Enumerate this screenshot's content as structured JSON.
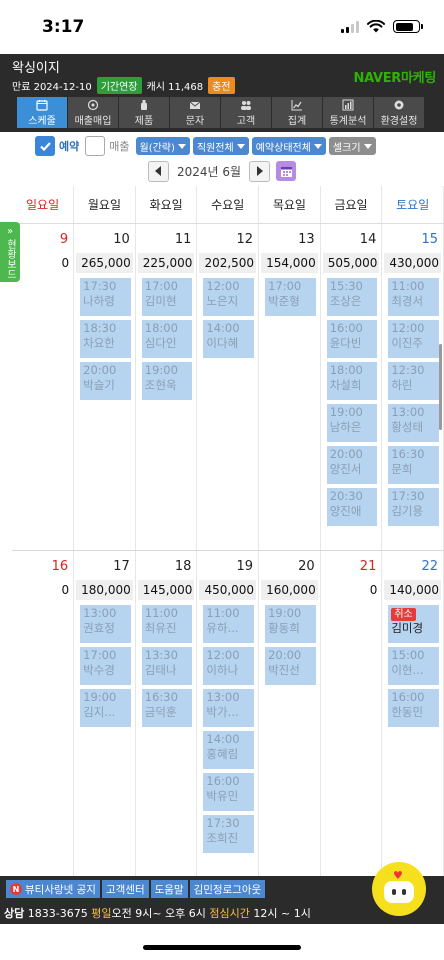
{
  "status_bar": {
    "time": "3:17"
  },
  "header": {
    "shop_name": "왁싱이지",
    "expiry": "만료 2024-12-10",
    "extend_label": "기간연장",
    "cash_label": "캐시 11,468",
    "charge_label": "충전",
    "brand_naver": "NAVER",
    "brand_marketing": "마케팅"
  },
  "toolbar": [
    {
      "label": "스케줄",
      "icon": "calendar-icon",
      "active": true
    },
    {
      "label": "매출매입",
      "icon": "coin-icon"
    },
    {
      "label": "제품",
      "icon": "product-icon"
    },
    {
      "label": "문자",
      "icon": "mail-icon"
    },
    {
      "label": "고객",
      "icon": "people-icon"
    },
    {
      "label": "집계",
      "icon": "line-chart-icon"
    },
    {
      "label": "통계분석",
      "icon": "bar-chart-icon"
    },
    {
      "label": "환경설정",
      "icon": "gear-icon"
    }
  ],
  "filters": {
    "reservation_label": "예약",
    "sales_label": "매출",
    "month_select": "월(간략)",
    "staff_select": "직원전체",
    "status_select": "예약상태전체",
    "cellsize_select": "셀크기"
  },
  "month_nav": {
    "label": "2024년 6월"
  },
  "side_tab": {
    "arrow": "»",
    "label": "현황보드"
  },
  "weekdays": [
    "일요일",
    "월요일",
    "화요일",
    "수요일",
    "목요일",
    "금요일",
    "토요일"
  ],
  "weeks": [
    {
      "days": [
        {
          "num": "9",
          "amount": "0",
          "appts": []
        },
        {
          "num": "10",
          "amount": "265,000",
          "appts": [
            {
              "time": "17:30",
              "name": "나하령"
            },
            {
              "time": "18:30",
              "name": "차요한"
            },
            {
              "time": "20:00",
              "name": "박슬기"
            }
          ]
        },
        {
          "num": "11",
          "amount": "225,000",
          "appts": [
            {
              "time": "17:00",
              "name": "김미현"
            },
            {
              "time": "18:00",
              "name": "심다인"
            },
            {
              "time": "19:00",
              "name": "조현욱"
            }
          ]
        },
        {
          "num": "12",
          "amount": "202,500",
          "appts": [
            {
              "time": "12:00",
              "name": "노은지"
            },
            {
              "time": "14:00",
              "name": "이다혜"
            }
          ]
        },
        {
          "num": "13",
          "amount": "154,000",
          "appts": [
            {
              "time": "17:00",
              "name": "박준형"
            }
          ]
        },
        {
          "num": "14",
          "amount": "505,000",
          "appts": [
            {
              "time": "15:30",
              "name": "조상은"
            },
            {
              "time": "16:00",
              "name": "윤다빈"
            },
            {
              "time": "18:00",
              "name": "차설희"
            },
            {
              "time": "19:00",
              "name": "남하은"
            },
            {
              "time": "20:00",
              "name": "양진서"
            },
            {
              "time": "20:30",
              "name": "양진애"
            }
          ]
        },
        {
          "num": "15",
          "amount": "430,000",
          "appts": [
            {
              "time": "11:00",
              "name": "최경서"
            },
            {
              "time": "12:00",
              "name": "이진주"
            },
            {
              "time": "12:30",
              "name": "하린"
            },
            {
              "time": "13:00",
              "name": "황성태"
            },
            {
              "time": "16:30",
              "name": "문희"
            },
            {
              "time": "17:30",
              "name": "김기용"
            }
          ]
        }
      ]
    },
    {
      "days": [
        {
          "num": "16",
          "amount": "0",
          "appts": []
        },
        {
          "num": "17",
          "amount": "180,000",
          "appts": [
            {
              "time": "13:00",
              "name": "권효정"
            },
            {
              "time": "17:00",
              "name": "박수경"
            },
            {
              "time": "19:00",
              "name": "김지..."
            }
          ]
        },
        {
          "num": "18",
          "amount": "145,000",
          "appts": [
            {
              "time": "11:00",
              "name": "최유진"
            },
            {
              "time": "13:30",
              "name": "김태나"
            },
            {
              "time": "16:30",
              "name": "금덕훈"
            }
          ]
        },
        {
          "num": "19",
          "amount": "450,000",
          "appts": [
            {
              "time": "11:00",
              "name": "유하..."
            },
            {
              "time": "12:00",
              "name": "이하나"
            },
            {
              "time": "13:00",
              "name": "박가..."
            },
            {
              "time": "14:00",
              "name": "홍혜림"
            },
            {
              "time": "16:00",
              "name": "박유민"
            },
            {
              "time": "17:30",
              "name": "조희진"
            }
          ]
        },
        {
          "num": "20",
          "amount": "160,000",
          "appts": [
            {
              "time": "19:00",
              "name": "황동희"
            },
            {
              "time": "20:00",
              "name": "박진선"
            }
          ]
        },
        {
          "num": "21",
          "amount": "0",
          "appts": []
        },
        {
          "num": "22",
          "amount": "140,000",
          "appts": [
            {
              "badge": "취소",
              "name": "김미경"
            },
            {
              "time": "15:00",
              "name": "이현..."
            },
            {
              "time": "16:00",
              "name": "한동민"
            }
          ]
        }
      ]
    }
  ],
  "bottom_buttons": [
    {
      "label": "뷰티사랑넷 공지",
      "badge": "N"
    },
    {
      "label": "고객센터"
    },
    {
      "label": "도움말"
    },
    {
      "label": "김민정로그아웃"
    }
  ],
  "footer": {
    "counsel_label": "상담",
    "phone": "1833-3675",
    "weekday_label": "평일",
    "hours": "오전 9시~ 오후 6시",
    "lunch_label": "점심시간",
    "lunch_hours": "12시 ~ 1시"
  },
  "colors": {
    "header_bg": "#2b2b2b",
    "accent_blue": "#4b88d0",
    "appointment_bg": "#b6d3f0",
    "sunday": "#d8241f",
    "saturday": "#2c74c9",
    "naver_green": "#2db400"
  }
}
